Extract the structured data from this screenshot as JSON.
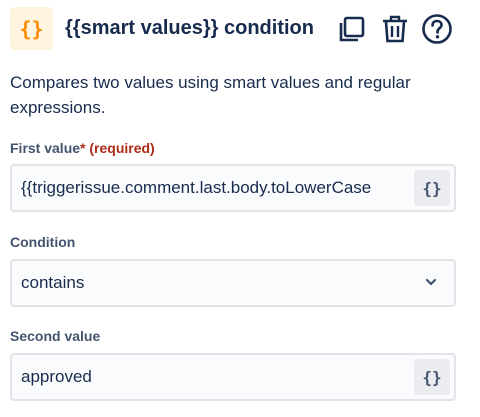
{
  "header": {
    "brand_icon_glyph": "{}",
    "title": "{{smart values}} condition",
    "icons": [
      "copy-icon",
      "trash-icon",
      "help-icon"
    ]
  },
  "description": "Compares two values using smart values and regular expressions.",
  "fields": {
    "first": {
      "label": "First value",
      "required_star": "*",
      "required_text": "(required)",
      "value": "{{triggerissue.comment.last.body.toLowerCase",
      "button_glyph": "{}"
    },
    "condition": {
      "label": "Condition",
      "value": "contains"
    },
    "second": {
      "label": "Second value",
      "value": "approved",
      "button_glyph": "{}"
    }
  },
  "colors": {
    "accent_orange": "#ff8b00",
    "brand_bg": "#fff4e0",
    "required_red": "#ae2a19",
    "text": "#172b4d"
  }
}
